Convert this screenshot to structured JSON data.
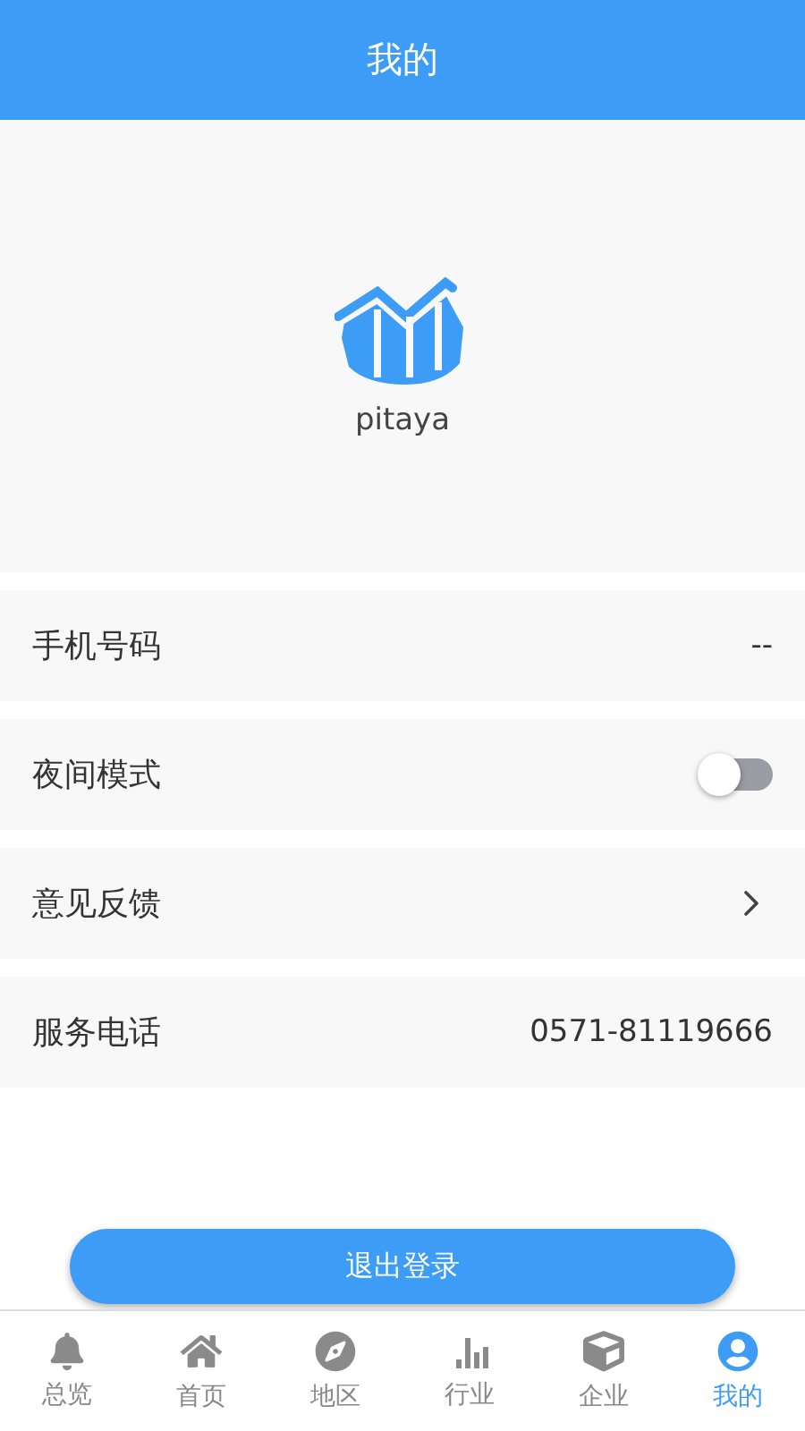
{
  "header": {
    "title": "我的"
  },
  "profile": {
    "username": "pitaya"
  },
  "settings": [
    {
      "kind": "value",
      "label": "手机号码",
      "value": "--"
    },
    {
      "kind": "toggle",
      "label": "夜间模式",
      "on": false
    },
    {
      "kind": "link",
      "label": "意见反馈"
    },
    {
      "kind": "value",
      "label": "服务电话",
      "value": "0571-81119666"
    }
  ],
  "logout_button": "退出登录",
  "tab_bar": [
    {
      "label": "总览",
      "selected": false
    },
    {
      "label": "首页",
      "selected": false
    },
    {
      "label": "地区",
      "selected": false
    },
    {
      "label": "行业",
      "selected": false
    },
    {
      "label": "企业",
      "selected": false
    },
    {
      "label": "我的",
      "selected": true
    }
  ]
}
